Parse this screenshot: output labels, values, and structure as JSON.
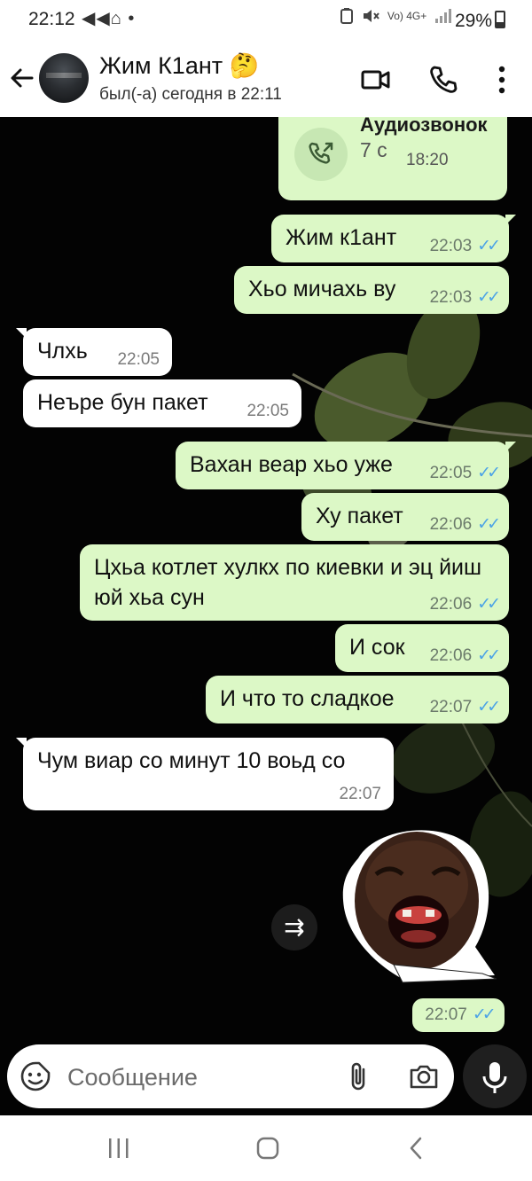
{
  "status_bar": {
    "time": "22:12",
    "left_icons": [
      "telegram-icon",
      "telegram-icon",
      "app-icon"
    ],
    "left_glyphs": "◀◀⌂ •",
    "right_icons": [
      "battery-saver-icon",
      "mute-icon",
      "volte-icon",
      "4g-icon",
      "signal-icon"
    ],
    "network_label": "Vo) 4G+",
    "battery": "29%"
  },
  "header": {
    "contact_name": "Жим К1ант",
    "contact_emoji": "🤔",
    "last_seen": "был(-а) сегодня в 22:11"
  },
  "call": {
    "title": "Аудиозвонок",
    "duration": "7 с",
    "time": "18:20"
  },
  "messages": [
    {
      "id": 1,
      "dir": "out",
      "text": "Жим к1ант",
      "time": "22:03",
      "read": true
    },
    {
      "id": 2,
      "dir": "out",
      "text": "Хьо мичахь ву",
      "time": "22:03",
      "read": true
    },
    {
      "id": 3,
      "dir": "in",
      "text": "Члхь",
      "time": "22:05"
    },
    {
      "id": 4,
      "dir": "in",
      "text": "Неъре бун пакет",
      "time": "22:05"
    },
    {
      "id": 5,
      "dir": "out",
      "text": "Вахан веар хьо уже",
      "time": "22:05",
      "read": true
    },
    {
      "id": 6,
      "dir": "out",
      "text": "Ху пакет",
      "time": "22:06",
      "read": true
    },
    {
      "id": 7,
      "dir": "out",
      "text": "Цхьа  котлет хулкх по киевки и эц йиш юй хьа сун",
      "time": "22:06",
      "read": true
    },
    {
      "id": 8,
      "dir": "out",
      "text": "И сок",
      "time": "22:06",
      "read": true
    },
    {
      "id": 9,
      "dir": "out",
      "text": "И что то сладкое",
      "time": "22:07",
      "read": true
    },
    {
      "id": 10,
      "dir": "in",
      "text": "Чум виар со минут 10 воьд со",
      "time": "22:07"
    }
  ],
  "sticker": {
    "time": "22:07",
    "read": true,
    "forward_glyph": "⇉"
  },
  "ticks": "✓✓",
  "input": {
    "placeholder": "Сообщение"
  },
  "colors": {
    "outgoing_bubble": "#dcf8c6",
    "incoming_bubble": "#ffffff",
    "read_ticks": "#4ca3e6",
    "chat_background": "#030303"
  }
}
